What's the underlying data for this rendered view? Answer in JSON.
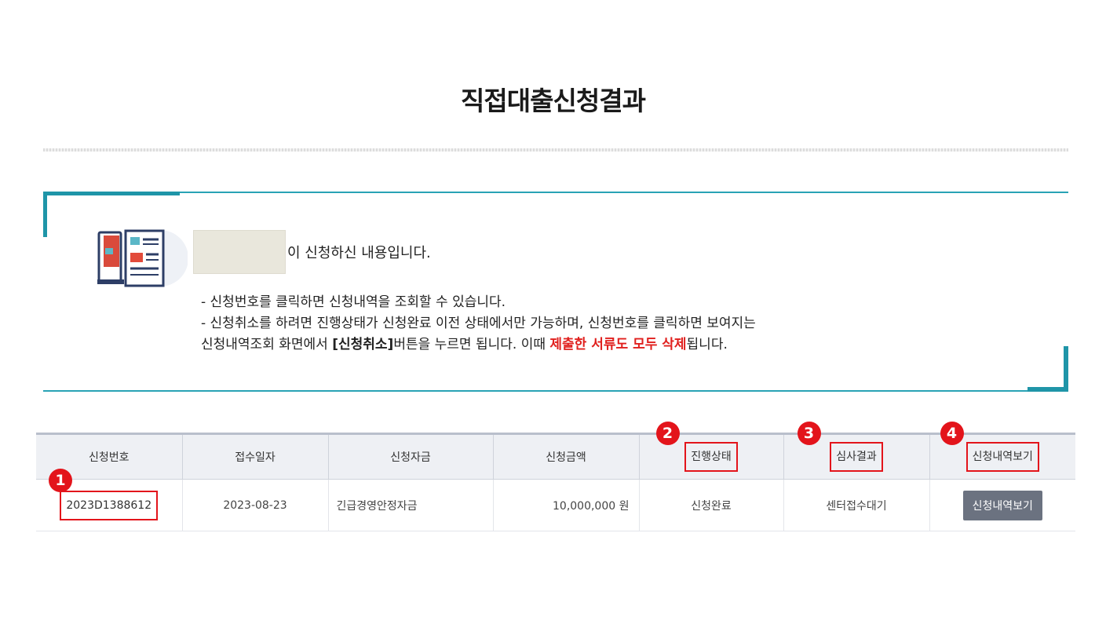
{
  "page": {
    "title": "직접대출신청결과"
  },
  "info": {
    "intro": "이 신청하신 내용입니다.",
    "notice_line1": "- 신청번호를 클릭하면 신청내역을 조회할 수 있습니다.",
    "notice_line2": "- 신청취소를 하려면 진행상태가 신청완료 이전 상태에서만 가능하며, 신청번호를 클릭하면 보여지는",
    "notice_line3_a": "신청내역조회 화면에서 ",
    "notice_line3_b": "[신청취소]",
    "notice_line3_c": "버튼을 누르면 됩니다. 이때 ",
    "notice_line3_red": "제출한 서류도 모두 삭제",
    "notice_line3_d": "됩니다."
  },
  "table": {
    "headers": [
      "신청번호",
      "접수일자",
      "신청자금",
      "신청금액",
      "진행상태",
      "심사결과",
      "신청내역보기"
    ],
    "rows": [
      {
        "app_no": "2023D1388612",
        "date": "2023-08-23",
        "fund": "긴급경영안정자금",
        "amount": "10,000,000 원",
        "status": "신청완료",
        "review": "센터접수대기",
        "view_button": "신청내역보기"
      }
    ]
  },
  "badges": [
    "1",
    "2",
    "3",
    "4"
  ],
  "colors": {
    "accent": "#1f95a8",
    "highlight_red": "#e3141b",
    "notice_red": "#e0201e",
    "button_gray": "#6b7280"
  }
}
